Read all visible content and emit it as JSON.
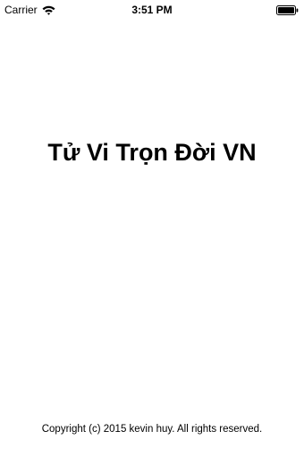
{
  "status_bar": {
    "carrier": "Carrier",
    "time": "3:51 PM",
    "wifi_icon": "wifi-icon",
    "battery_icon": "battery-full-icon"
  },
  "main": {
    "title": "Tử Vi Trọn Đời VN"
  },
  "footer": {
    "copyright": "Copyright (c) 2015 kevin huy. All rights reserved."
  }
}
